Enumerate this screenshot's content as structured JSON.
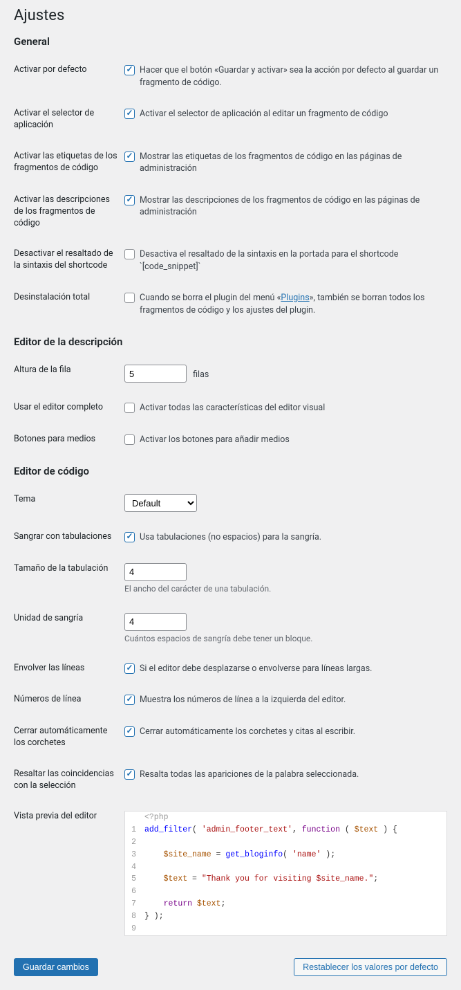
{
  "page_title": "Ajustes",
  "sections": {
    "general": {
      "heading": "General",
      "activate_default": {
        "label": "Activar por defecto",
        "desc": "Hacer que el botón «Guardar y activar» sea la acción por defecto al guardar un fragmento de código.",
        "checked": true
      },
      "scope_selector": {
        "label": "Activar el selector de aplicación",
        "desc": "Activar el selector de aplicación al editar un fragmento de código",
        "checked": true
      },
      "snippet_tags": {
        "label": "Activar las etiquetas de los fragmentos de código",
        "desc": "Mostrar las etiquetas de los fragmentos de código en las páginas de administración",
        "checked": true
      },
      "snippet_desc": {
        "label": "Activar las descripciones de los fragmentos de código",
        "desc": "Mostrar las descripciones de los fragmentos de código en las páginas de administración",
        "checked": true
      },
      "disable_syntax": {
        "label": "Desactivar el resaltado de la sintaxis del shortcode",
        "desc": "Desactiva el resaltado de la sintaxis en la portada para el shortcode `[code_snippet]`",
        "checked": false
      },
      "complete_uninstall": {
        "label": "Desinstalación total",
        "desc_pre": "Cuando se borra el plugin del menú «",
        "link_text": "Plugins",
        "desc_post": "», también se borran todos los fragmentos de código y los ajustes del plugin.",
        "checked": false
      }
    },
    "desc_editor": {
      "heading": "Editor de la descripción",
      "row_height": {
        "label": "Altura de la fila",
        "value": "5",
        "suffix": "filas"
      },
      "full_editor": {
        "label": "Usar el editor completo",
        "desc": "Activar todas las características del editor visual",
        "checked": false
      },
      "media_buttons": {
        "label": "Botones para medios",
        "desc": "Activar los botones para añadir medios",
        "checked": false
      }
    },
    "code_editor": {
      "heading": "Editor de código",
      "theme": {
        "label": "Tema",
        "value": "Default"
      },
      "indent_tabs": {
        "label": "Sangrar con tabulaciones",
        "desc": "Usa tabulaciones (no espacios) para la sangría.",
        "checked": true
      },
      "tab_size": {
        "label": "Tamaño de la tabulación",
        "value": "4",
        "help": "El ancho del carácter de una tabulación."
      },
      "indent_unit": {
        "label": "Unidad de sangría",
        "value": "4",
        "help": "Cuántos espacios de sangría debe tener un bloque."
      },
      "line_wrap": {
        "label": "Envolver las líneas",
        "desc": "Si el editor debe desplazarse o envolverse para líneas largas.",
        "checked": true
      },
      "line_numbers": {
        "label": "Números de línea",
        "desc": "Muestra los números de línea a la izquierda del editor.",
        "checked": true
      },
      "auto_close": {
        "label": "Cerrar automáticamente los corchetes",
        "desc": "Cerrar automáticamente los corchetes y citas al escribir.",
        "checked": true
      },
      "highlight_sel": {
        "label": "Resaltar las coincidencias con la selección",
        "desc": "Resalta todas las apariciones de la palabra seleccionada.",
        "checked": true
      },
      "preview": {
        "label": "Vista previa del editor"
      }
    }
  },
  "code_lines": {
    "l0": "<?php",
    "l1": "1",
    "l2": "2",
    "l3": "3",
    "l4": "4",
    "l5": "5",
    "l6": "6",
    "l7": "7",
    "l8": "8",
    "l9": "9"
  },
  "buttons": {
    "save": "Guardar cambios",
    "reset": "Restablecer los valores por defecto"
  }
}
